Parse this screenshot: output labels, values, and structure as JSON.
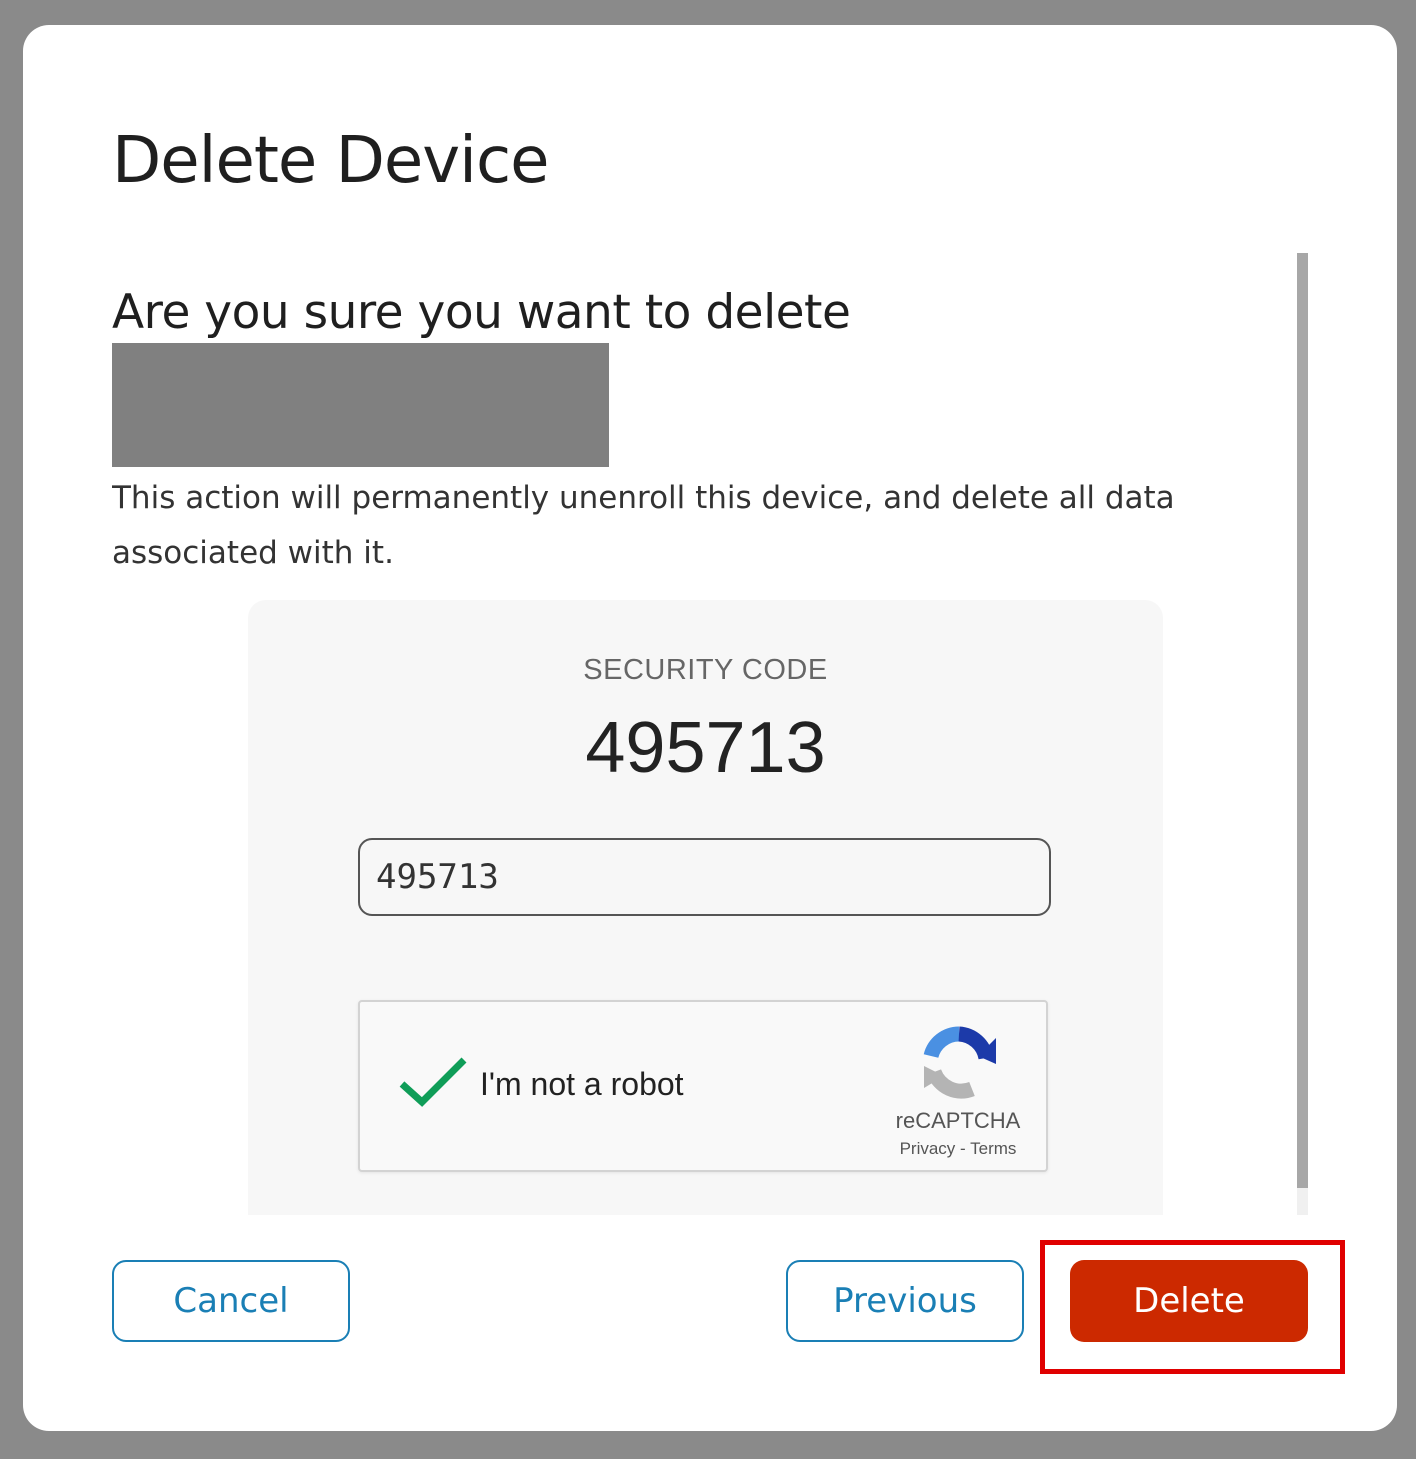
{
  "dialog": {
    "title": "Delete Device",
    "question": "Are you sure you want to delete",
    "description": "This action will permanently unenroll this device, and delete all data associated with it."
  },
  "security": {
    "label": "SECURITY CODE",
    "code": "495713",
    "input_value": "495713"
  },
  "recaptcha": {
    "label": "I'm not a robot",
    "brand": "reCAPTCHA",
    "privacy": "Privacy",
    "separator": " - ",
    "terms": "Terms",
    "checked": true
  },
  "buttons": {
    "cancel": "Cancel",
    "previous": "Previous",
    "delete": "Delete"
  },
  "colors": {
    "accent": "#1a7fb5",
    "danger": "#cc2900",
    "highlight": "#e00000",
    "check": "#0f9d58"
  }
}
